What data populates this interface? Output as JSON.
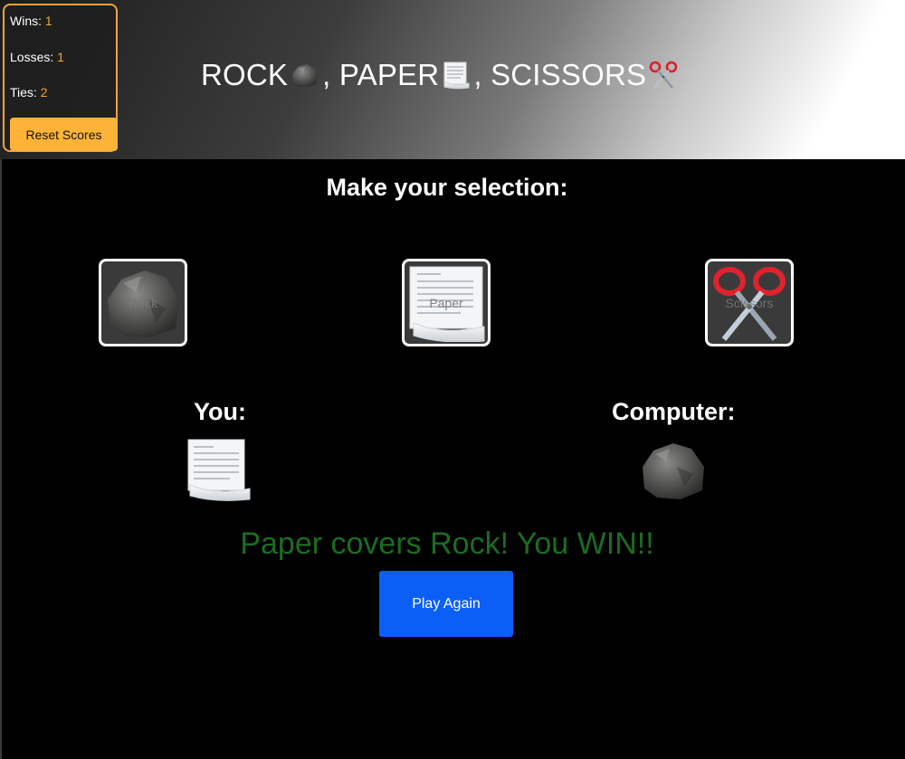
{
  "scores": {
    "wins_label": "Wins:",
    "wins": "1",
    "losses_label": "Losses:",
    "losses": "1",
    "ties_label": "Ties:",
    "ties": "2",
    "reset_label": "Reset Scores"
  },
  "title": {
    "part1": "ROCK",
    "part2": ", PAPER",
    "part3": ", SCISSORS",
    "icons": [
      "rock-icon",
      "paper-icon",
      "scissors-icon"
    ]
  },
  "prompt": "Make your selection:",
  "choices": [
    {
      "label": "Rock",
      "icon": "rock-icon"
    },
    {
      "label": "Paper",
      "icon": "paper-icon"
    },
    {
      "label": "Scissors",
      "icon": "scissors-icon"
    }
  ],
  "you_label": "You:",
  "computer_label": "Computer:",
  "you_pick": "paper-icon",
  "computer_pick": "rock-icon",
  "result_text": "Paper covers Rock! You WIN!!",
  "play_again_label": "Play Again",
  "colors": {
    "accent": "#f2a33a",
    "reset_button": "#fdb338",
    "result": "#1b6d21",
    "play_button": "#0b5ff7"
  }
}
